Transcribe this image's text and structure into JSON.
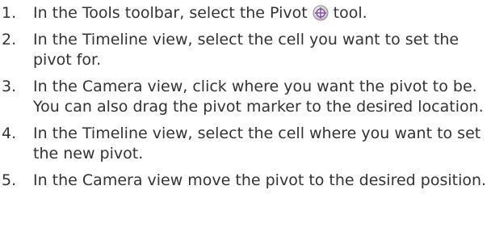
{
  "steps": [
    {
      "number": "1.",
      "text_before": "In the Tools toolbar, select the Pivot",
      "icon": "pivot-tool-icon",
      "text_after": "tool."
    },
    {
      "number": "2.",
      "text": "In the Timeline view, select the cell you want to set the pivot for."
    },
    {
      "number": "3.",
      "text": "In the Camera view, click where you want the pivot to be. You can also drag the pivot marker to the desired location."
    },
    {
      "number": "4.",
      "text": "In the Timeline view, select the cell where you want to set the new pivot."
    },
    {
      "number": "5.",
      "text": "In the Camera view move the pivot to the desired position."
    }
  ]
}
